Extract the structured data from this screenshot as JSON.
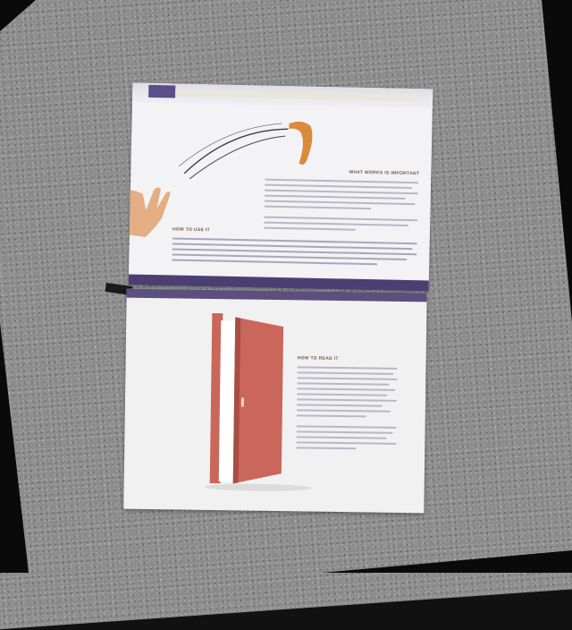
{
  "scene": {
    "description_visible_text": [],
    "top_page": {
      "heading_right": "WHAT WORKS IS IMPORTANT",
      "heading_left": "HOW TO USE IT",
      "illustration": "boomerang-illustration",
      "band_color": "#4b3f72",
      "header_tab_color": "#5c4e86"
    },
    "bottom_page": {
      "heading": "HOW TO READ IT",
      "illustration": "open-door-illustration",
      "door_color": "#c9675b",
      "band_color": "#5a4f7d"
    },
    "colors": {
      "carpet": "#8c8c8c",
      "page": "#f3f3f5",
      "boomerang": "#d98a3a",
      "hand": "#e0a070"
    }
  }
}
